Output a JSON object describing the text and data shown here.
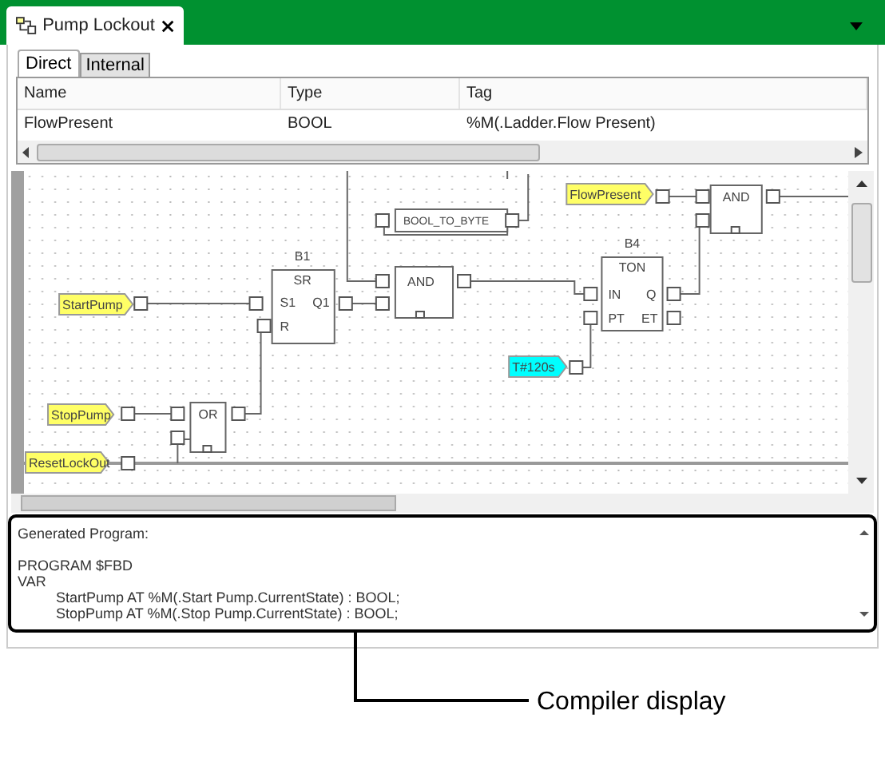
{
  "document_tab": {
    "title": "Pump Lockout"
  },
  "variable_tabs": [
    {
      "label": "Direct",
      "selected": true
    },
    {
      "label": "Internal",
      "selected": false
    }
  ],
  "table": {
    "columns": [
      "Name",
      "Type",
      "Tag"
    ],
    "rows": [
      [
        "FlowPresent",
        "BOOL",
        "%M(.Ladder.Flow Present)"
      ]
    ]
  },
  "diagram": {
    "tags": [
      {
        "text": "FlowPresent",
        "color": "#ffff66"
      },
      {
        "text": "StartPump",
        "color": "#ffff66"
      },
      {
        "text": "T#120s",
        "color": "#00ffff"
      },
      {
        "text": "StopPump",
        "color": "#ffff66"
      },
      {
        "text": "ResetLockOut",
        "color": "#ffff66"
      }
    ],
    "blocks": [
      {
        "type": "AND"
      },
      {
        "type": "BOOL_TO_BYTE"
      },
      {
        "instance": "B1",
        "type": "SR",
        "pins": [
          "S1",
          "Q1",
          "R"
        ]
      },
      {
        "type": "AND"
      },
      {
        "instance": "B4",
        "type": "TON",
        "pins": [
          "IN",
          "Q",
          "PT",
          "ET"
        ]
      },
      {
        "type": "OR"
      }
    ]
  },
  "compiler": {
    "header": "Generated Program:",
    "program_lines": [
      "PROGRAM $FBD",
      "VAR"
    ],
    "declarations": [
      "StartPump AT %M(.Start Pump.CurrentState) : BOOL;",
      "StopPump AT %M(.Stop Pump.CurrentState) : BOOL;"
    ]
  },
  "callout": {
    "label": "Compiler display"
  }
}
